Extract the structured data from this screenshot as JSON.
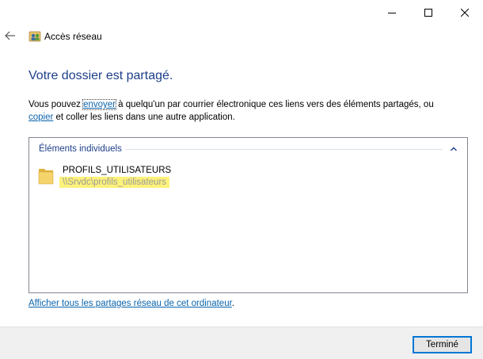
{
  "window": {
    "title": "Accès réseau",
    "controls": {
      "minimize": "minimize-icon",
      "maximize": "maximize-icon",
      "close": "close-icon"
    }
  },
  "main": {
    "heading": "Votre dossier est partagé.",
    "description": {
      "part1": "Vous pouvez ",
      "link_send": "envoyer",
      "part2": " à quelqu'un par courrier électronique ces liens vers des éléments partagés, ou",
      "link_copy": "copier",
      "part3": " et coller les liens dans une autre application."
    }
  },
  "shared_items": {
    "group_label": "Éléments individuels",
    "items": [
      {
        "name": "PROFILS_UTILISATEURS",
        "path": "\\\\Srvdc\\profils_utilisateurs"
      }
    ]
  },
  "links": {
    "show_all": "Afficher tous les partages réseau de cet ordinateur",
    "show_all_suffix": "."
  },
  "footer": {
    "done_label": "Terminé"
  },
  "colors": {
    "heading": "#1e3f8a",
    "link": "#0a64ad",
    "highlight": "#fdf27a",
    "accent_border": "#0078d7"
  }
}
